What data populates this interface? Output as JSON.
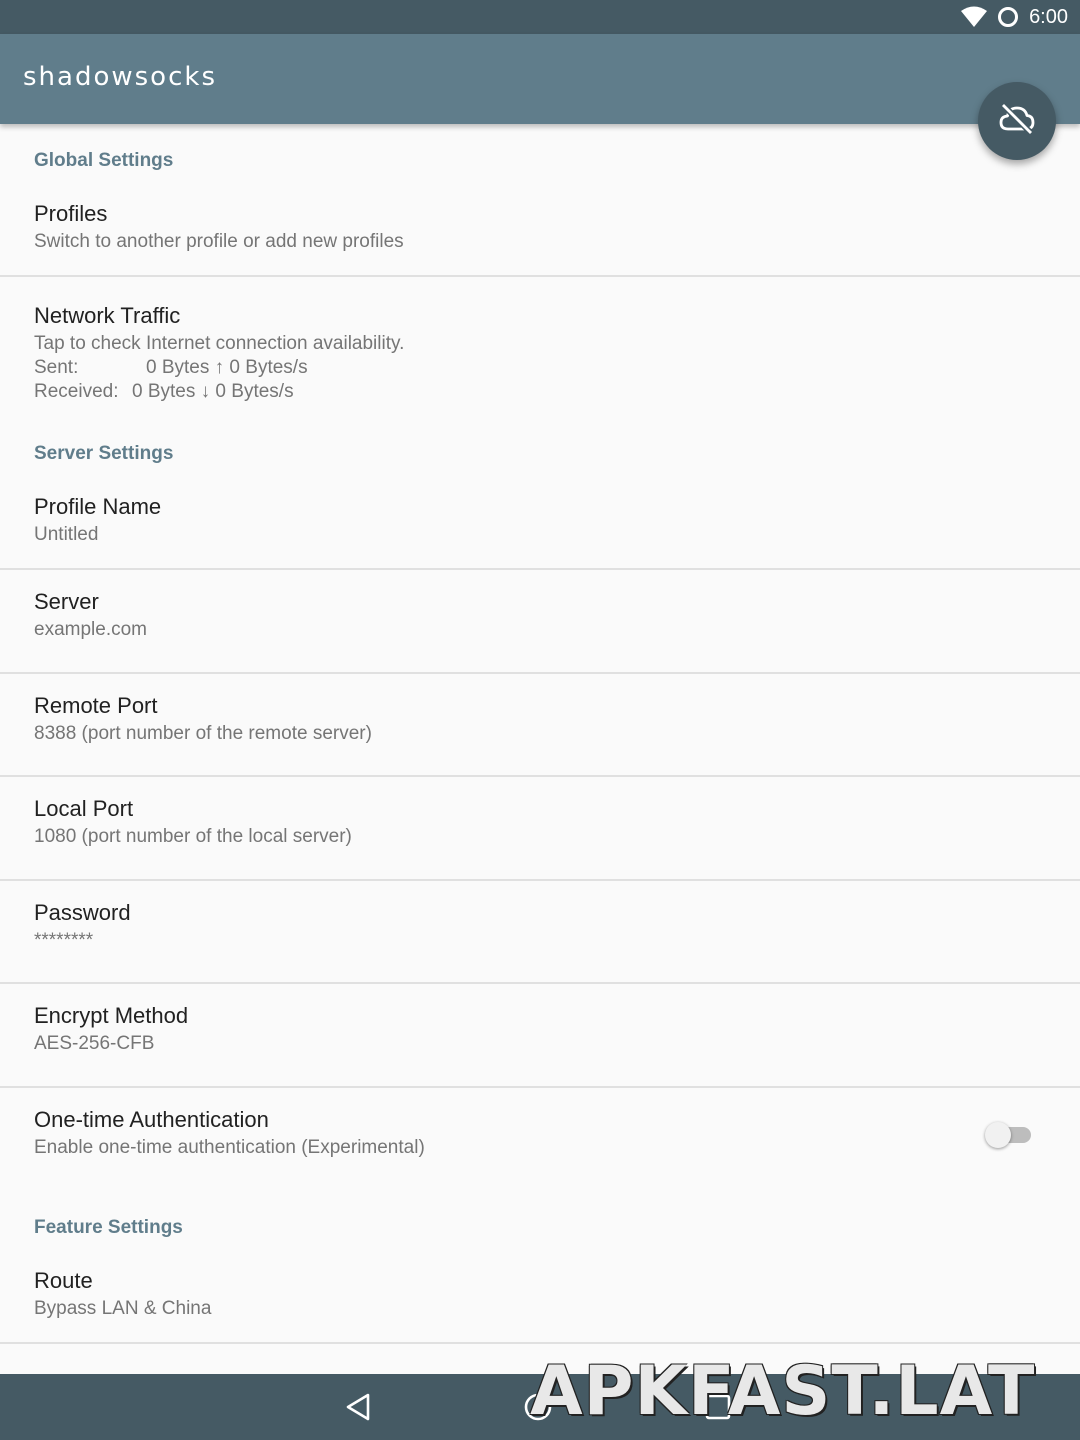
{
  "status_bar": {
    "time": "6:00",
    "icons": [
      "wifi-icon",
      "circle-status-icon"
    ]
  },
  "app_bar": {
    "title": "shadowsocks"
  },
  "fab": {
    "icon": "cloud-off-icon"
  },
  "sections": {
    "global": {
      "header": "Global Settings",
      "profiles": {
        "title": "Profiles",
        "summary": "Switch to another profile or add new profiles"
      },
      "traffic": {
        "title": "Network Traffic",
        "summary": "Tap to check Internet connection availability.",
        "sent_label": "Sent:",
        "sent_value": "0 Bytes ↑ 0 Bytes/s",
        "received_label": "Received:",
        "received_value": "0 Bytes ↓ 0 Bytes/s"
      }
    },
    "server": {
      "header": "Server Settings",
      "items": [
        {
          "title": "Profile Name",
          "summary": "Untitled"
        },
        {
          "title": "Server",
          "summary": "example.com"
        },
        {
          "title": "Remote Port",
          "summary": "8388 (port number of the remote server)"
        },
        {
          "title": "Local Port",
          "summary": "1080 (port number of the local server)"
        },
        {
          "title": "Password",
          "summary": "********"
        },
        {
          "title": "Encrypt Method",
          "summary": "AES-256-CFB"
        }
      ],
      "ota": {
        "title": "One-time Authentication",
        "summary": "Enable one-time authentication (Experimental)",
        "enabled": false
      }
    },
    "feature": {
      "header": "Feature Settings",
      "route": {
        "title": "Route",
        "summary": "Bypass LAN & China"
      }
    }
  },
  "nav_bar": {
    "icons": [
      "back-icon",
      "home-icon",
      "recents-icon"
    ]
  },
  "watermark": "APKFAST.LAT",
  "colors": {
    "primary": "#607d8b",
    "primary_dark": "#455a64",
    "accent_text": "#607d8b"
  }
}
